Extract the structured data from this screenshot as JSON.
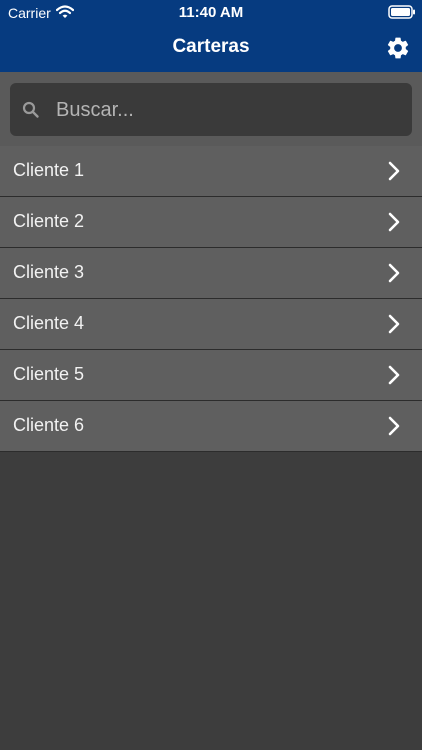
{
  "status_bar": {
    "carrier": "Carrier",
    "time": "11:40 AM",
    "wifi_icon": "wifi-icon",
    "battery_icon": "battery-icon"
  },
  "nav": {
    "title": "Carteras",
    "settings_icon": "gear-icon",
    "color": "#063b80"
  },
  "search": {
    "placeholder": "Buscar...",
    "value": "",
    "icon": "search-icon"
  },
  "list": {
    "items": [
      {
        "label": "Cliente 1"
      },
      {
        "label": "Cliente 2"
      },
      {
        "label": "Cliente 3"
      },
      {
        "label": "Cliente 4"
      },
      {
        "label": "Cliente 5"
      },
      {
        "label": "Cliente 6"
      }
    ],
    "chevron_icon": "chevron-right-icon"
  }
}
